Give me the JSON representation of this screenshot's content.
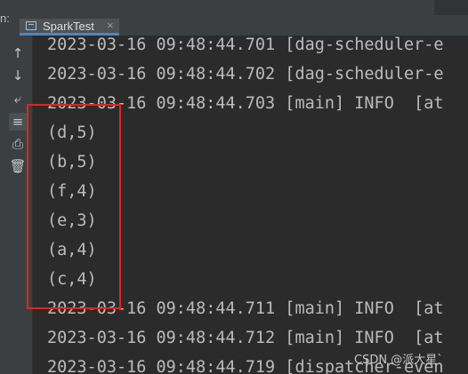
{
  "tabbar": {
    "left_label": "n:",
    "tab_title": "SparkTest",
    "tab_close": "×"
  },
  "toolbar": {
    "icons": [
      "up-arrow-icon",
      "down-arrow-icon",
      "soft-wrap-icon",
      "scroll-to-end-icon",
      "print-icon",
      "trash-icon"
    ]
  },
  "console": {
    "lines": [
      "2023-03-16 09:48:44.701 [dag-scheduler-e",
      "2023-03-16 09:48:44.702 [dag-scheduler-e",
      "2023-03-16 09:48:44.703 [main] INFO  [at",
      "(d,5)",
      "(b,5)",
      "(f,4)",
      "(e,3)",
      "(a,4)",
      "(c,4)",
      "2023-03-16 09:48:44.711 [main] INFO  [at",
      "2023-03-16 09:48:44.712 [main] INFO  [at",
      "2023-03-16 09:48:44.719 [dispatcher-even"
    ]
  },
  "watermark": "CSDN @派大星`"
}
